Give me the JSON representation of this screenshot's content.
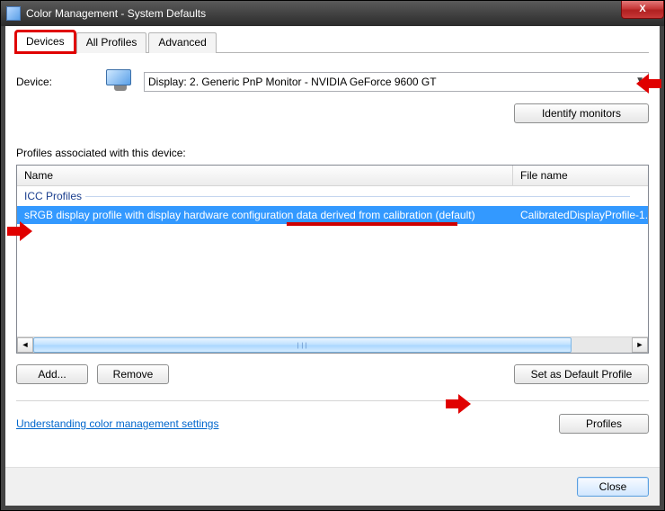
{
  "window": {
    "title": "Color Management - System Defaults",
    "close_glyph": "X"
  },
  "tabs": {
    "devices": "Devices",
    "all_profiles": "All Profiles",
    "advanced": "Advanced"
  },
  "device": {
    "label": "Device:",
    "selected": "Display: 2. Generic PnP Monitor - NVIDIA GeForce 9600 GT",
    "identify_btn": "Identify monitors"
  },
  "profiles": {
    "heading": "Profiles associated with this device:",
    "columns": {
      "name": "Name",
      "file": "File name"
    },
    "group": "ICC Profiles",
    "rows": [
      {
        "name": "sRGB display profile with display hardware configuration data derived from calibration (default)",
        "file": "CalibratedDisplayProfile-1."
      }
    ]
  },
  "buttons": {
    "add": "Add...",
    "remove": "Remove",
    "set_default": "Set as Default Profile",
    "profiles": "Profiles",
    "close": "Close"
  },
  "link": {
    "understand": "Understanding color management settings"
  }
}
